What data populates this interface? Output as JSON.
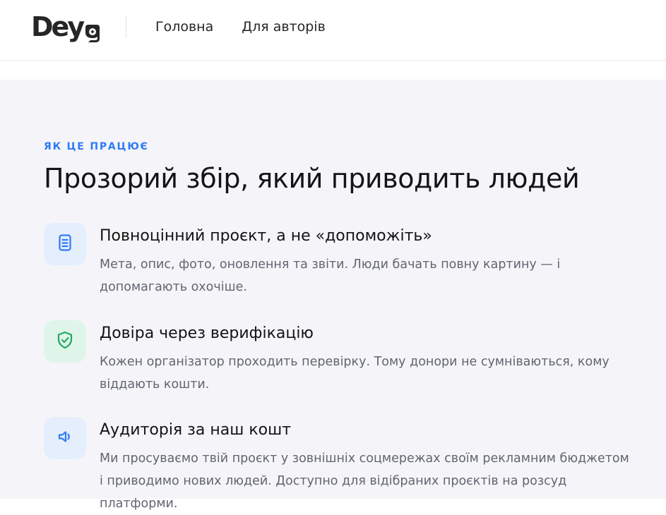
{
  "header": {
    "logo_text": "Deya",
    "nav": [
      "Головна",
      "Для авторів"
    ]
  },
  "section": {
    "eyebrow": "ЯК ЦЕ ПРАЦЮЄ",
    "title": "Прозорий збір, який приводить людей"
  },
  "features": [
    {
      "icon": "document-icon",
      "title": "Повноцінний проєкт, а не «допоможіть»",
      "desc": "Мета, опис, фото, оновлення та звіти. Люди бачать повну картину — і допомагають охочіше."
    },
    {
      "icon": "shield-check-icon",
      "title": "Довіра через верифікацію",
      "desc": "Кожен організатор проходить перевірку. Тому донори не сумніваються, кому віддають кошти."
    },
    {
      "icon": "megaphone-icon",
      "title": "Аудиторія за наш кошт",
      "desc": "Ми просуваємо твій проєкт у зовнішніх соцмережах своїм рекламним бюджетом і приводимо нових людей. Доступно для відібраних проєктів на розсуд платформи."
    }
  ],
  "colors": {
    "accent": "#2e7bf6",
    "green": "#22a861",
    "section_bg": "#f5f5f9"
  }
}
